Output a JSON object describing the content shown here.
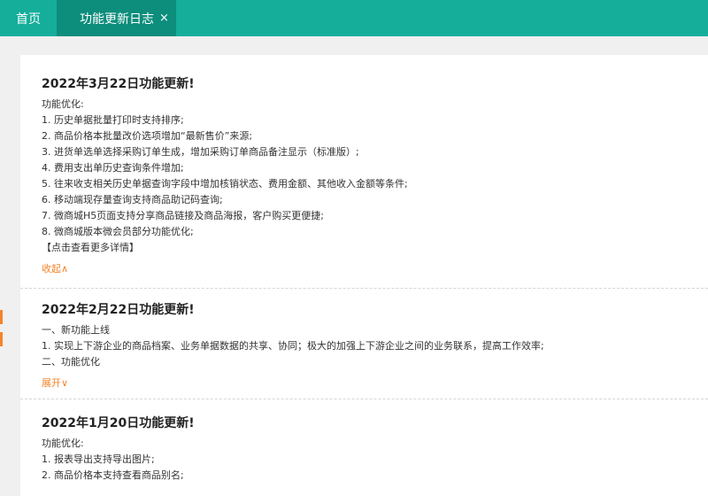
{
  "tabs": {
    "home": "首页",
    "active": "功能更新日志",
    "close": "×"
  },
  "sections": [
    {
      "title": "2022年3月22日功能更新!",
      "intro": "功能优化:",
      "lines": [
        "1. 历史单据批量打印时支持排序;",
        "2. 商品价格本批量改价选项增加“最新售价”来源;",
        "3. 进货单选单选择采购订单生成，增加采购订单商品备注显示（标准版）;",
        "4. 费用支出单历史查询条件增加;",
        "5. 往来收支相关历史单据查询字段中增加核销状态、费用金额、其他收入金额等条件;",
        "6. 移动端现存量查询支持商品助记码查询;",
        "7. 微商城H5页面支持分享商品链接及商品海报，客户购买更便捷;",
        "8. 微商城版本微会员部分功能优化;",
        "【点击查看更多详情】"
      ],
      "toggle": "收起∧"
    },
    {
      "title": "2022年2月22日功能更新!",
      "intro": "一、新功能上线",
      "lines": [
        "1. 实现上下游企业的商品档案、业务单据数据的共享、协同；极大的加强上下游企业之间的业务联系，提高工作效率;",
        "二、功能优化"
      ],
      "toggle": "展开∨"
    },
    {
      "title": "2022年1月20日功能更新!",
      "intro": "功能优化:",
      "lines": [
        "1. 报表导出支持导出图片;",
        "2. 商品价格本支持查看商品别名;"
      ]
    }
  ],
  "colors": {
    "topbar": "#14ae9a",
    "active_tab": "#0d8d7c",
    "accent": "#f5832b"
  }
}
